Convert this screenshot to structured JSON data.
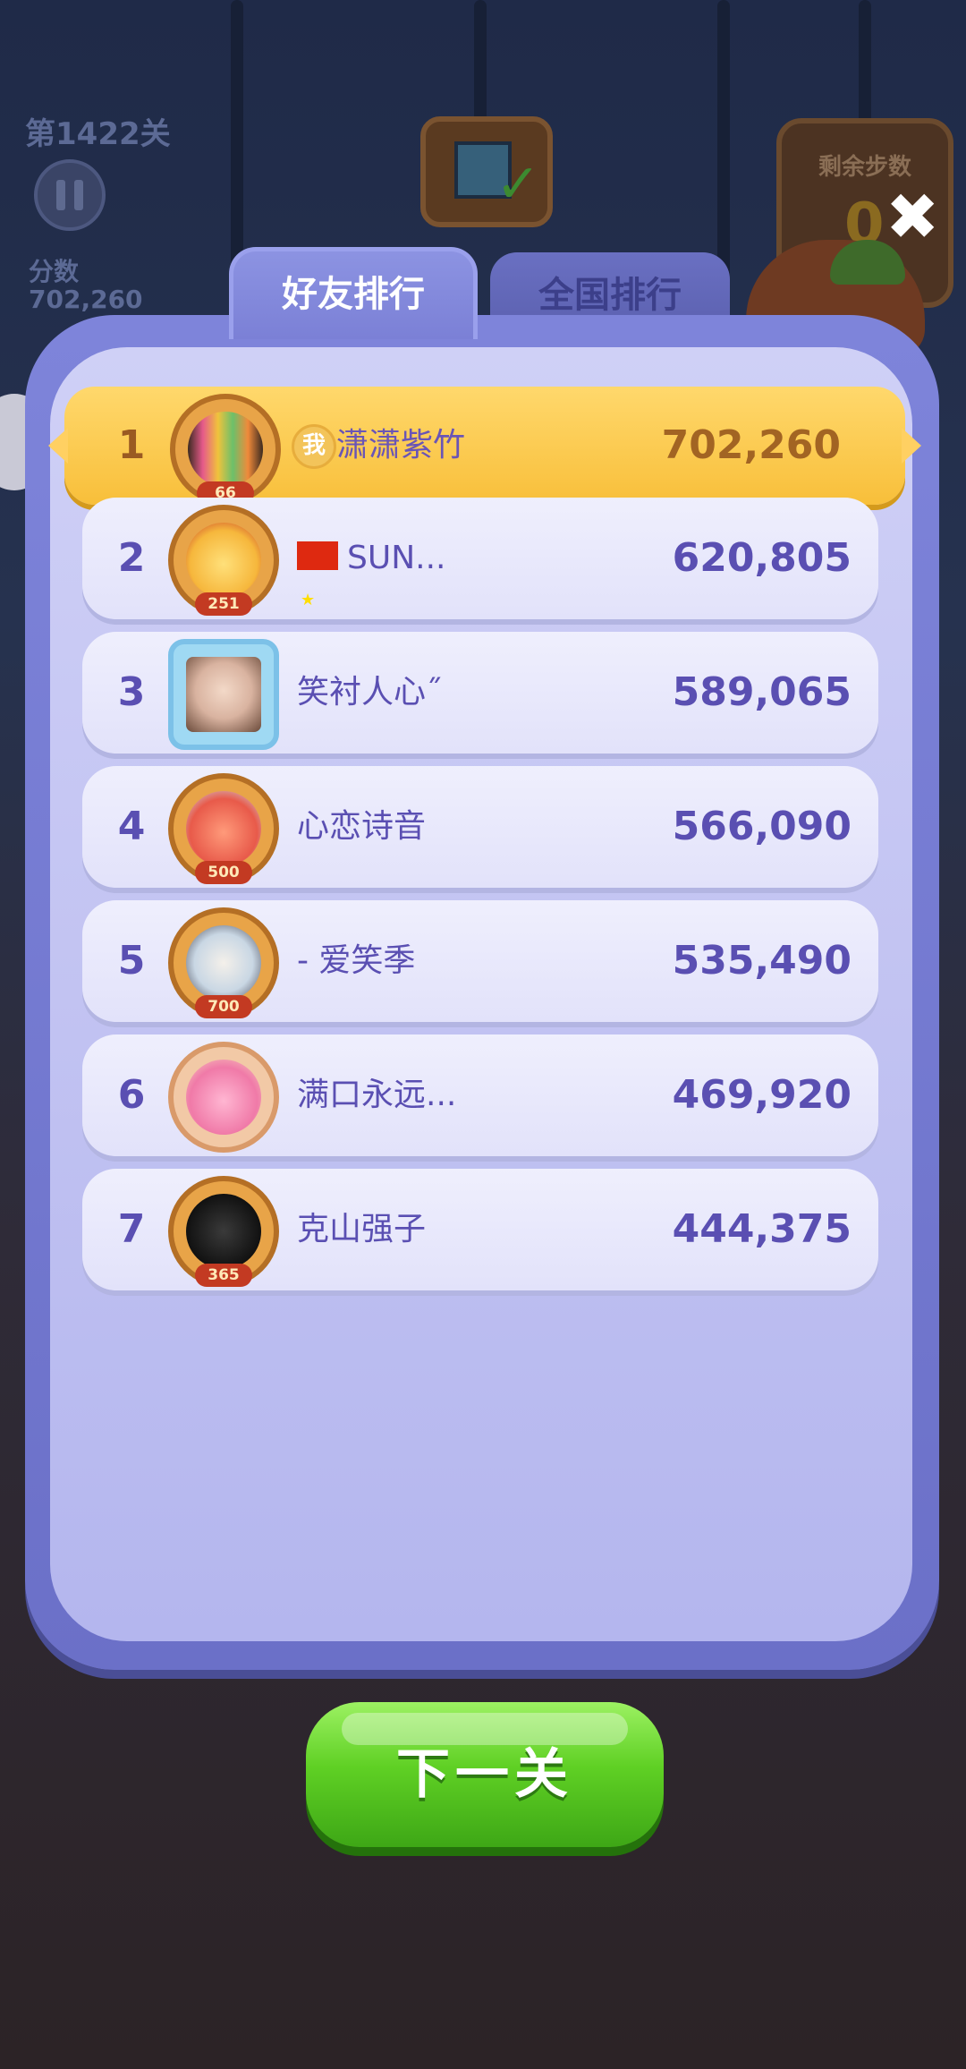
{
  "background": {
    "level_label": "第1422关",
    "score_label": "分数",
    "score_value": "702,260",
    "moves_label": "剩余步数",
    "moves_value": "0"
  },
  "tabs": [
    {
      "label": "好友排行",
      "active": true
    },
    {
      "label": "全国排行",
      "active": false
    }
  ],
  "me_tag": "我",
  "leaderboard": [
    {
      "rank": "1",
      "name": "潇潇紫竹",
      "score": "702,260",
      "avatar_level": "66",
      "is_me": true
    },
    {
      "rank": "2",
      "name": "SUN...",
      "score": "620,805",
      "avatar_level": "251",
      "flag": "china-flag-icon"
    },
    {
      "rank": "3",
      "name": "笑衬人心˝",
      "score": "589,065"
    },
    {
      "rank": "4",
      "name": "心恋诗音",
      "score": "566,090",
      "avatar_level": "500"
    },
    {
      "rank": "5",
      "name": "- 爱笑季",
      "score": "535,490",
      "avatar_level": "700"
    },
    {
      "rank": "6",
      "name": "满口永远...",
      "score": "469,920"
    },
    {
      "rank": "7",
      "name": "克山强子",
      "score": "444,375",
      "avatar_level": "365"
    }
  ],
  "next_button_label": "下一关",
  "colors": {
    "panel": "#7e84da",
    "row": "#efeffd",
    "highlight_row": "#ffd86c",
    "text_purple": "#5a4fb2",
    "next_button": "#5fd024"
  }
}
